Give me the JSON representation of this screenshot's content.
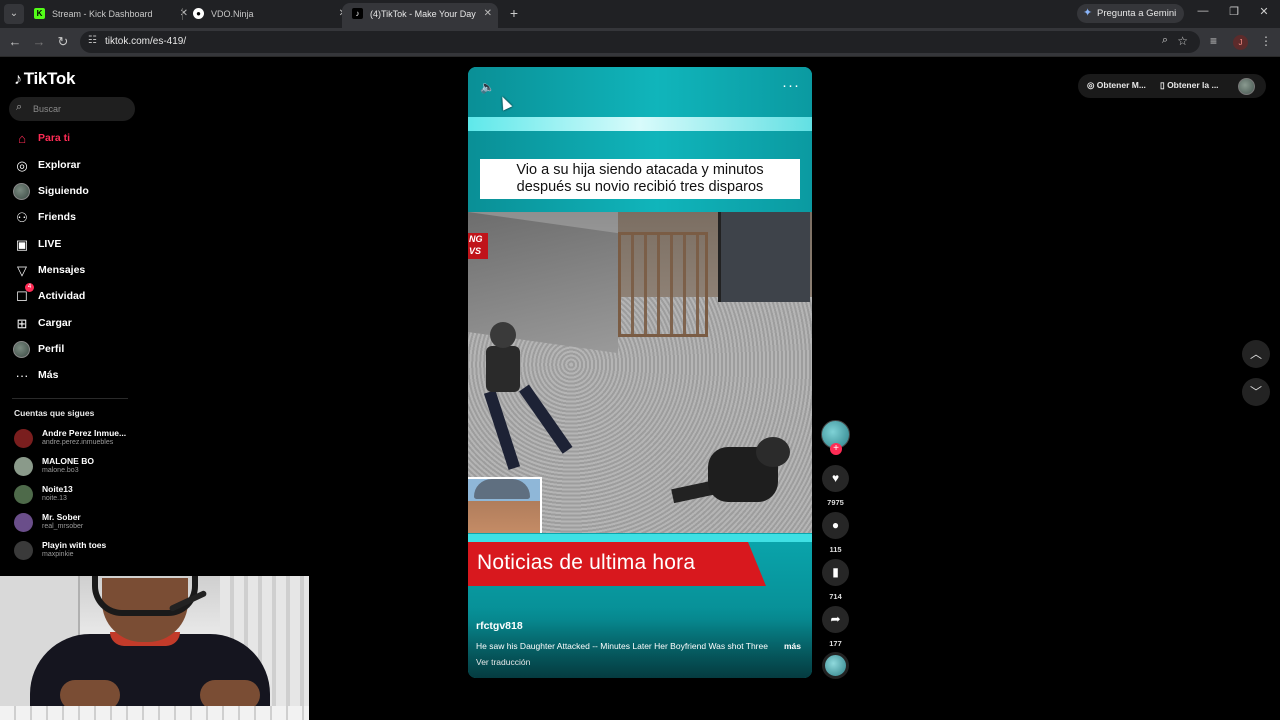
{
  "browser": {
    "tabs": [
      {
        "title": "Stream - Kick Dashboard",
        "favicon": "kick-icon",
        "color": "#53fc18",
        "active": false
      },
      {
        "title": "VDO.Ninja",
        "favicon": "vdo-ninja-icon",
        "color": "#ffffff",
        "active": false
      },
      {
        "title": "(4)TikTok - Make Your Day",
        "favicon": "tiktok-icon",
        "color": "#ffffff",
        "active": true
      }
    ],
    "gemini_label": "Pregunta a Gemini",
    "url": "tiktok.com/es-419/",
    "profile_initial": "J"
  },
  "sidebar": {
    "logo_text": "TikTok",
    "search_placeholder": "Buscar",
    "nav": [
      {
        "label": "Para ti",
        "icon": "home-icon",
        "active": true
      },
      {
        "label": "Explorar",
        "icon": "compass-icon"
      },
      {
        "label": "Siguiendo",
        "icon": "avatar-icon"
      },
      {
        "label": "Friends",
        "icon": "friends-icon"
      },
      {
        "label": "LIVE",
        "icon": "live-icon"
      },
      {
        "label": "Mensajes",
        "icon": "messages-icon"
      },
      {
        "label": "Actividad",
        "icon": "activity-icon",
        "badge": "4"
      },
      {
        "label": "Cargar",
        "icon": "upload-icon"
      },
      {
        "label": "Perfil",
        "icon": "profile-icon"
      },
      {
        "label": "Más",
        "icon": "more-icon"
      }
    ],
    "following_title": "Cuentas que sigues",
    "accounts": [
      {
        "name": "Andre Perez Inmue...",
        "handle": "andre.perez.inmuebles",
        "color": "#7a1e1e"
      },
      {
        "name": "MALONE BO",
        "handle": "malone.bo3",
        "color": "#8a9a8a"
      },
      {
        "name": "Noite13",
        "handle": "noite.13",
        "color": "#4e6a4a"
      },
      {
        "name": "Mr. Sober",
        "handle": "real_mrsober",
        "color": "#6a4e8a"
      },
      {
        "name": "Playin with toes",
        "handle": "maxpinkie",
        "color": "#3a3a3a"
      }
    ]
  },
  "video": {
    "headline_line1": "Vio a su hija siendo atacada y minutos",
    "headline_line2": "después su novio recibió tres disparos",
    "news_tag": "NG VS",
    "breaking_text": "Noticias de ultima hora",
    "author": "rfctgv818",
    "description": "He saw his Daughter Attacked -- Minutes Later Her Boyfriend Was shot  Three",
    "more_label": "más",
    "translate_label": "Ver traducción"
  },
  "actions": {
    "likes": "7975",
    "comments": "115",
    "saves": "714",
    "shares": "177"
  },
  "top_right": {
    "coins_label": "Obtener M...",
    "app_label": "Obtener la ..."
  },
  "colors": {
    "accent": "#fe2c55",
    "player_teal": "#0b9aa1",
    "breaking_red": "#d8181e"
  }
}
